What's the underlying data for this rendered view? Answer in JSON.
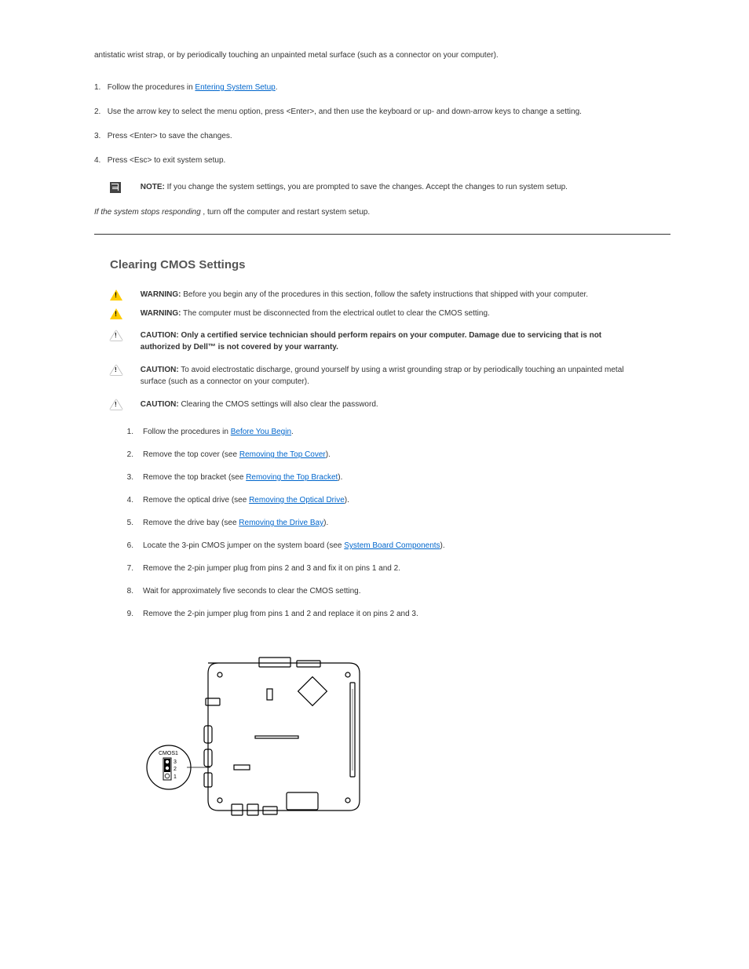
{
  "antistatic_text": "antistatic wrist strap, or by periodically touching an unpainted metal surface (such as a connector on your computer).",
  "step_enter_1": "1.",
  "step_enter_1_text_a": "Follow the procedures in ",
  "step_enter_1_link": "Entering System Setup",
  "step_enter_1_text_b": ".",
  "step_enter_2": "2.",
  "step_enter_2_text": "Use the arrow key to select the menu option, press <Enter>, and then use the keyboard or up- and down-arrow keys to change a setting.",
  "step_enter_3": "3.",
  "step_enter_3_text": "Press <Enter> to save the changes.",
  "step_enter_4": "4.",
  "step_enter_4_text": "Press <Esc> to exit system setup.",
  "note_row_label": "NOTE:",
  "note_row_text": " If you change the system settings, you are prompted to save the changes. Accept the changes to run system setup.",
  "cmos_sub": "If the system stops responding",
  "cmos_sub_text": ", turn off the computer and restart system setup.",
  "clearing_heading": "Clearing CMOS Settings",
  "warn1_label": "WARNING:",
  "warn1_text": " Before you begin any of the procedures in this section, follow the safety instructions that shipped with your computer.",
  "warn2_label": "WARNING:",
  "warn2_text": " The computer must be disconnected from the electrical outlet to clear the CMOS setting.",
  "caut1_label": "CAUTION: Only a certified service technician should perform repairs on your computer. Damage due to servicing that is not authorized by Dell™ is not covered by your warranty.",
  "caut2_label": "CAUTION:",
  "caut2_text": " To avoid electrostatic discharge, ground yourself by using a wrist grounding strap or by periodically touching an unpainted metal surface (such as a connector on your computer).",
  "caut3_label": "CAUTION:",
  "caut3_text": " Clearing the CMOS settings will also clear the password.",
  "s1n": "1.",
  "s1a": "Follow the procedures in ",
  "s1l": "Before You Begin",
  "s1b": ".",
  "s2n": "2.",
  "s2a": "Remove the top cover (see ",
  "s2l": "Removing the Top Cover",
  "s2b": ").",
  "s3n": "3.",
  "s3a": "Remove the top bracket (see ",
  "s3l": "Removing the Top Bracket",
  "s3b": ").",
  "s4n": "4.",
  "s4a": "Remove the optical drive (see ",
  "s4l": "Removing the Optical Drive",
  "s4b": ").",
  "s5n": "5.",
  "s5a": "Remove the drive bay (see ",
  "s5l": "Removing the Drive Bay",
  "s5b": ").",
  "s6n": "6.",
  "s6a": "Locate the 3-pin CMOS jumper on the system board (see ",
  "s6l": "System Board Components",
  "s6b": ").",
  "s7n": "7.",
  "s7": "Remove the 2-pin jumper plug from pins 2 and 3 and fix it on pins 1 and 2.",
  "s8n": "8.",
  "s8": "Wait for approximately five seconds to clear the CMOS setting.",
  "s9n": "9.",
  "s9": "Remove the 2-pin jumper plug from pins 1 and 2 and replace it on pins 2 and 3.",
  "jumper_label": "CMOS1",
  "pin3": "3",
  "pin2": "2",
  "pin1": "1"
}
